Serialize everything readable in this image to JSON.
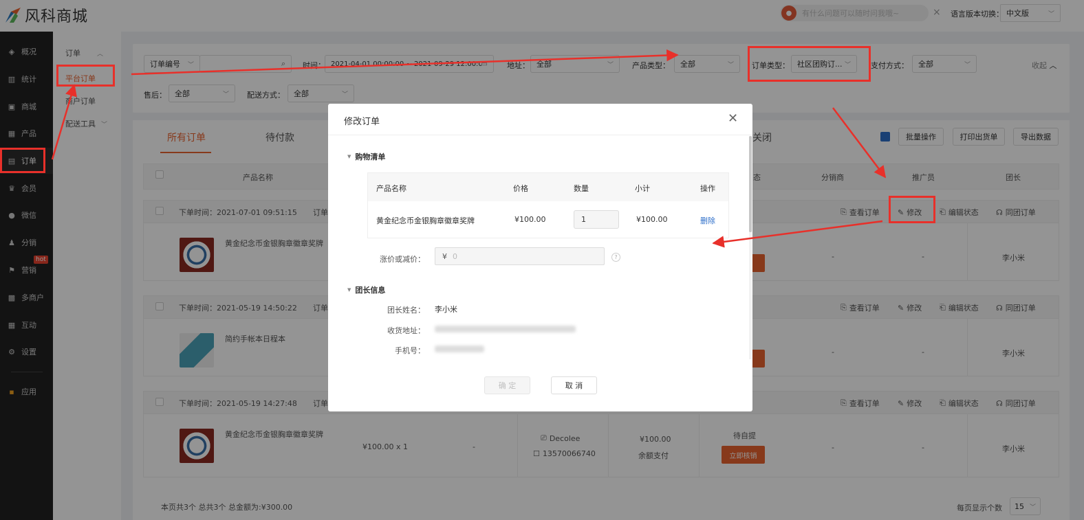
{
  "brand": {
    "name": "风科商城",
    "colors": {
      "accent": "#e8632f",
      "annotation": "#e8302a",
      "link": "#2d6ec9"
    }
  },
  "topbar": {
    "assistant_placeholder": "有什么问题可以随时问我哦~",
    "assistant_close": "×",
    "language_label": "语言版本切换：",
    "language_value": "中文版"
  },
  "nav": {
    "items": [
      {
        "label": "概况",
        "icon": "layers-icon"
      },
      {
        "label": "统计",
        "icon": "chart-icon"
      },
      {
        "label": "商城",
        "icon": "shop-icon"
      },
      {
        "label": "产品",
        "icon": "grid-icon"
      },
      {
        "label": "订单",
        "icon": "clipboard-icon"
      },
      {
        "label": "会员",
        "icon": "crown-icon"
      },
      {
        "label": "微信",
        "icon": "wechat-icon"
      },
      {
        "label": "分销",
        "icon": "users-icon"
      },
      {
        "label": "营销",
        "icon": "flag-icon"
      },
      {
        "label": "多商户",
        "icon": "store-icon"
      },
      {
        "label": "互动",
        "icon": "grid-icon"
      },
      {
        "label": "设置",
        "icon": "gear-icon"
      },
      {
        "label": "应用",
        "icon": "apps-icon"
      }
    ],
    "hot_badge": "hot"
  },
  "subnav": {
    "group": "订单",
    "items": [
      "平台订单",
      "商户订单",
      "配送工具"
    ]
  },
  "filters": {
    "order_no_type": "订单编号",
    "time_label": "时间：",
    "time_value": "2021-04-01 00:00:00 ~ 2021-09-29 12:00:00",
    "address_label": "地址：",
    "address_value": "全部",
    "product_type_label": "产品类型：",
    "product_type_value": "全部",
    "order_type_label": "订单类型：",
    "order_type_value": "社区团购订...",
    "payment_label": "支付方式：",
    "payment_value": "全部",
    "collapse": "收起",
    "after_sale_label": "售后：",
    "after_sale_value": "全部",
    "delivery_label": "配送方式：",
    "delivery_value": "全部"
  },
  "tabs": {
    "all": "所有订单",
    "pending_pay": "待付款",
    "closed": "关闭"
  },
  "toolbar": {
    "batch": "批量操作",
    "print": "打印出货单",
    "export": "导出数据"
  },
  "table_headers": {
    "product": "产品名称",
    "status": "态",
    "distributor": "分销商",
    "promoter": "推广员",
    "leader": "团长"
  },
  "orders": [
    {
      "time": "下单时间：2021-07-01 09:51:15",
      "no_label": "订单",
      "product": "黄金纪念币金银胸章徽章奖牌",
      "distributor": "-",
      "promoter": "-",
      "leader": "李小米"
    },
    {
      "time": "下单时间：2021-05-19 14:50:22",
      "no_label": "订单",
      "product": "简约手帐本日程本",
      "distributor": "-",
      "promoter": "-",
      "leader": "李小米"
    },
    {
      "time": "下单时间：2021-05-19 14:27:48",
      "no_label": "订单",
      "product": "黄金纪念币金银胸章徽章奖牌",
      "price_qty": "¥100.00  x 1",
      "dash": "-",
      "customer": "Decolee",
      "phone": "13570066740",
      "amount": "¥100.00",
      "pay_method": "余额支付",
      "status": "待自提",
      "verify": "立即核销",
      "distributor": "-",
      "promoter": "-",
      "leader": "李小米"
    }
  ],
  "row_actions": {
    "view": "查看订单",
    "edit": "修改",
    "edit_status": "编辑状态",
    "group": "同团订单"
  },
  "modal": {
    "title": "修改订单",
    "cart_section": "购物清单",
    "cart_headers": {
      "name": "产品名称",
      "price": "价格",
      "qty": "数量",
      "subtotal": "小计",
      "op": "操作"
    },
    "cart_row": {
      "name": "黄金纪念币金银胸章徽章奖牌",
      "price": "¥100.00",
      "qty": "1",
      "subtotal": "¥100.00",
      "delete": "删除"
    },
    "adjust_label": "涨价或减价：",
    "adjust_currency": "¥",
    "adjust_placeholder": "0",
    "leader_section": "团长信息",
    "leader_name_label": "团长姓名：",
    "leader_name": "李小米",
    "address_label": "收货地址：",
    "phone_label": "手机号：",
    "ok": "确 定",
    "cancel": "取 消"
  },
  "footer": {
    "summary": "本页共3个  总共3个  总金额为:¥300.00",
    "page_size_label": "每页显示个数",
    "page_size": "15"
  }
}
